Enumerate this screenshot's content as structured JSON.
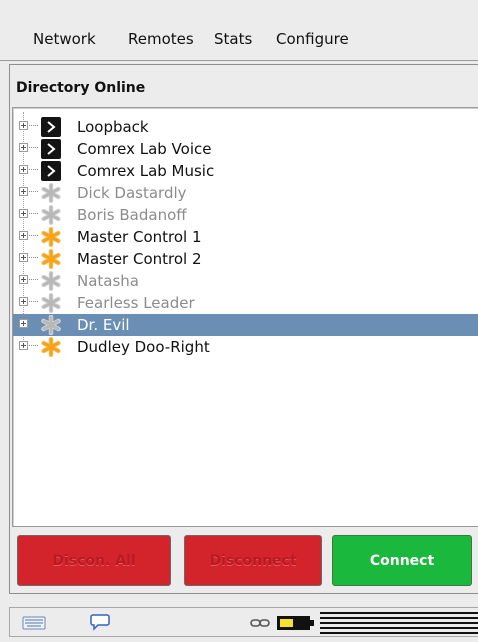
{
  "menu": {
    "items": [
      "Network",
      "Remotes",
      "Stats",
      "Configure"
    ]
  },
  "panel": {
    "title": "Directory Online",
    "entries": [
      {
        "label": "Loopback",
        "icon": "terminal-icon",
        "status": "online"
      },
      {
        "label": "Comrex Lab Voice",
        "icon": "terminal-icon",
        "status": "online"
      },
      {
        "label": "Comrex Lab Music",
        "icon": "terminal-icon",
        "status": "online"
      },
      {
        "label": "Dick Dastardly",
        "icon": "gray-asterisk-icon",
        "status": "offline"
      },
      {
        "label": "Boris Badanoff",
        "icon": "gray-asterisk-icon",
        "status": "offline"
      },
      {
        "label": "Master Control 1",
        "icon": "orange-asterisk-icon",
        "status": "available"
      },
      {
        "label": "Master Control 2",
        "icon": "orange-asterisk-icon",
        "status": "available"
      },
      {
        "label": "Natasha",
        "icon": "gray-asterisk-icon",
        "status": "offline"
      },
      {
        "label": "Fearless Leader",
        "icon": "gray-asterisk-icon",
        "status": "offline"
      },
      {
        "label": "Dr. Evil",
        "icon": "gray-asterisk-icon",
        "status": "offline",
        "selected": true
      },
      {
        "label": "Dudley Doo-Right",
        "icon": "orange-asterisk-icon",
        "status": "available"
      }
    ]
  },
  "buttons": {
    "disconnect_all": "Discon. All",
    "disconnect": "Disconnect",
    "connect": "Connect"
  },
  "statusbar": {
    "icons": [
      "keyboard-icon",
      "chat-bubble-icon",
      "link-icon",
      "battery-level-icon"
    ]
  },
  "colors": {
    "selected_row": "#6b8fb4",
    "red_button": "#d3242b",
    "green_button": "#1bb83e",
    "orange_asterisk": "#f7a21b",
    "gray_asterisk": "#b8b8b8"
  }
}
